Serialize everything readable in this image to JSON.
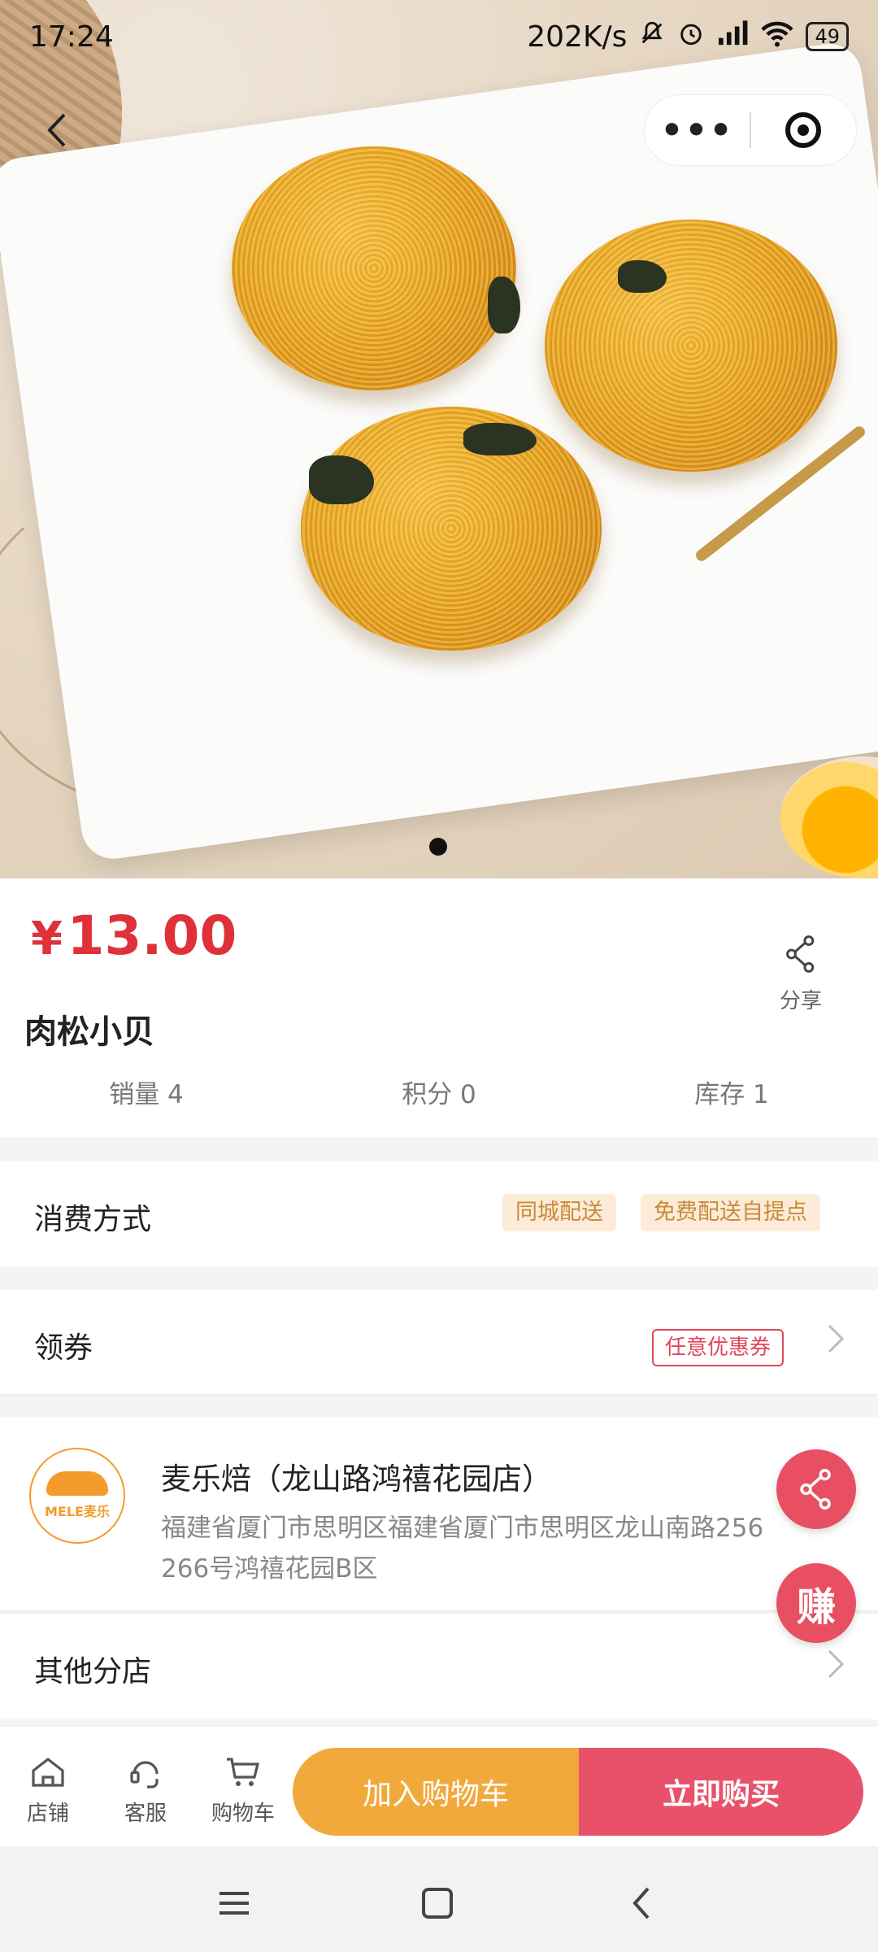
{
  "status_bar": {
    "time": "17:24",
    "network_speed": "202K/s",
    "battery": "49",
    "icons": [
      "mute-icon",
      "alarm-icon",
      "signal-icon",
      "wifi-icon",
      "battery-icon"
    ]
  },
  "header": {
    "back_icon": "back-icon",
    "more_icon": "more-icon",
    "target_icon": "target-icon"
  },
  "carousel": {
    "current": 1,
    "total": 1
  },
  "product": {
    "currency": "¥",
    "price": "13.00",
    "name": "肉松小贝",
    "share_label": "分享",
    "sales": "销量 4",
    "points": "积分 0",
    "stock": "库存 1",
    "price_color": "#e0303a"
  },
  "consumption": {
    "label": "消费方式",
    "tags": [
      "同城配送",
      "免费配送自提点"
    ]
  },
  "coupon": {
    "label": "领券",
    "tag": "任意优惠券"
  },
  "store": {
    "logo_text": "MELE麦乐",
    "name": "麦乐焙（龙山路鸿禧花园店）",
    "address": "福建省厦门市思明区福建省厦门市思明区龙山南路256 266号鸿禧花园B区"
  },
  "branches": {
    "label": "其他分店"
  },
  "fab": {
    "share_icon": "share-icon",
    "earn_label": "赚"
  },
  "bottom_bar": {
    "tabs": [
      {
        "label": "店铺",
        "icon": "store-icon"
      },
      {
        "label": "客服",
        "icon": "customer-service-icon"
      },
      {
        "label": "购物车",
        "icon": "cart-icon"
      }
    ],
    "add_to_cart": "加入购物车",
    "buy_now": "立即购买",
    "add_color": "#f2a93b",
    "buy_color": "#e9516a"
  },
  "system_nav": {
    "icons": [
      "menu-icon",
      "home-icon",
      "back-icon"
    ]
  }
}
